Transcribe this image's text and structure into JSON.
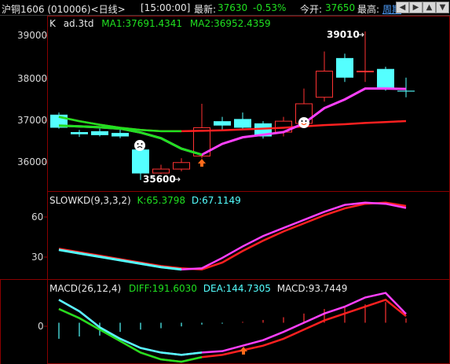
{
  "header": {
    "symbol": "沪铜1606 (010006)<日线>",
    "time": "[15:00:00]",
    "latest_label": "最新:",
    "latest_value": "37630",
    "change": "-0.53%",
    "open_label": "今开:",
    "open_value": "37650",
    "high_label": "最高:",
    "period_link": "周期",
    "buttons": [
      "prev-icon",
      "next-icon",
      "zoom-out-icon",
      "zoom-in-icon",
      "expand-icon"
    ]
  },
  "panels": {
    "k": {
      "name": "K",
      "formula": "ad.3td",
      "ma1_label": "MA1:37691.4341",
      "ma2_label": "MA2:36952.4359"
    },
    "kd": {
      "name": "SLOWKD(9,3,3,2)",
      "k_label": "K:65.3798",
      "d_label": "D:67.1149"
    },
    "macd": {
      "name": "MACD(26,12,4)",
      "diff_label": "DIFF:191.6030",
      "dea_label": "DEA:144.7305",
      "macd_label": "MACD:93.7449"
    }
  },
  "annotations": {
    "high": "39010",
    "low": "35600"
  },
  "axes": {
    "price_ticks": [
      "39000",
      "38000",
      "37000",
      "36000"
    ],
    "kd_ticks": [
      "60",
      "30"
    ],
    "macd_ticks": [
      "0"
    ]
  },
  "colors": {
    "up": "#ff3232",
    "down": "#54ffff",
    "ma1": "#ff40ff",
    "ma2": "#ff2020",
    "green": "#20e020"
  },
  "chart_data": {
    "type": "line",
    "candles": [
      {
        "o": 37100,
        "h": 37150,
        "l": 36780,
        "c": 36800
      },
      {
        "o": 36700,
        "h": 36750,
        "l": 36590,
        "c": 36650
      },
      {
        "o": 36720,
        "h": 36780,
        "l": 36600,
        "c": 36630
      },
      {
        "o": 36680,
        "h": 36760,
        "l": 36560,
        "c": 36600
      },
      {
        "o": 36300,
        "h": 36400,
        "l": 35600,
        "c": 35750
      },
      {
        "o": 35760,
        "h": 35950,
        "l": 35740,
        "c": 35850
      },
      {
        "o": 35850,
        "h": 36100,
        "l": 35800,
        "c": 36000
      },
      {
        "o": 36150,
        "h": 37350,
        "l": 36100,
        "c": 36800
      },
      {
        "o": 36950,
        "h": 37050,
        "l": 36750,
        "c": 36850
      },
      {
        "o": 37000,
        "h": 37150,
        "l": 36750,
        "c": 36800
      },
      {
        "o": 36900,
        "h": 36950,
        "l": 36550,
        "c": 36600
      },
      {
        "o": 36700,
        "h": 37050,
        "l": 36600,
        "c": 36950
      },
      {
        "o": 36900,
        "h": 37700,
        "l": 36800,
        "c": 37350
      },
      {
        "o": 37500,
        "h": 38550,
        "l": 37400,
        "c": 38100
      },
      {
        "o": 38400,
        "h": 38500,
        "l": 37850,
        "c": 37950
      },
      {
        "o": 38100,
        "h": 39010,
        "l": 37850,
        "c": 38100
      },
      {
        "o": 38150,
        "h": 38200,
        "l": 37650,
        "c": 37700
      },
      {
        "o": 37650,
        "h": 37950,
        "l": 37500,
        "c": 37630
      }
    ],
    "ma1": [
      36850,
      36830,
      36810,
      36780,
      36690,
      36560,
      36320,
      36180,
      36430,
      36580,
      36640,
      36700,
      36900,
      37250,
      37450,
      37700,
      37700,
      37691
    ],
    "ma2": [
      37050,
      36950,
      36870,
      36800,
      36750,
      36720,
      36720,
      36730,
      36740,
      36760,
      36780,
      36800,
      36830,
      36860,
      36880,
      36910,
      36930,
      36952
    ],
    "price_axis": [
      35400,
      39300
    ],
    "slowk": [
      29,
      26,
      23,
      20,
      17,
      14,
      12,
      13,
      22,
      32,
      41,
      48,
      55,
      62,
      68,
      70,
      69,
      65.3798
    ],
    "slowd": [
      30,
      27,
      24,
      21,
      18,
      15,
      13,
      12,
      18,
      28,
      37,
      45,
      52,
      59,
      65,
      69,
      70,
      67.1149
    ],
    "kd_axis": [
      5,
      78
    ],
    "diff": [
      500,
      250,
      -100,
      -350,
      -550,
      -650,
      -700,
      -650,
      -620,
      -500,
      -380,
      -200,
      0,
      200,
      350,
      550,
      650,
      191.603
    ],
    "dea": [
      300,
      100,
      -150,
      -400,
      -650,
      -800,
      -850,
      -750,
      -700,
      -600,
      -500,
      -350,
      -150,
      50,
      200,
      350,
      500,
      144.7305
    ],
    "macd_hist": [
      -350,
      -300,
      -280,
      -200,
      -150,
      -120,
      -80,
      -40,
      -20,
      20,
      60,
      120,
      200,
      300,
      350,
      400,
      450,
      93.7449
    ],
    "macd_axis": [
      -900,
      900
    ]
  }
}
